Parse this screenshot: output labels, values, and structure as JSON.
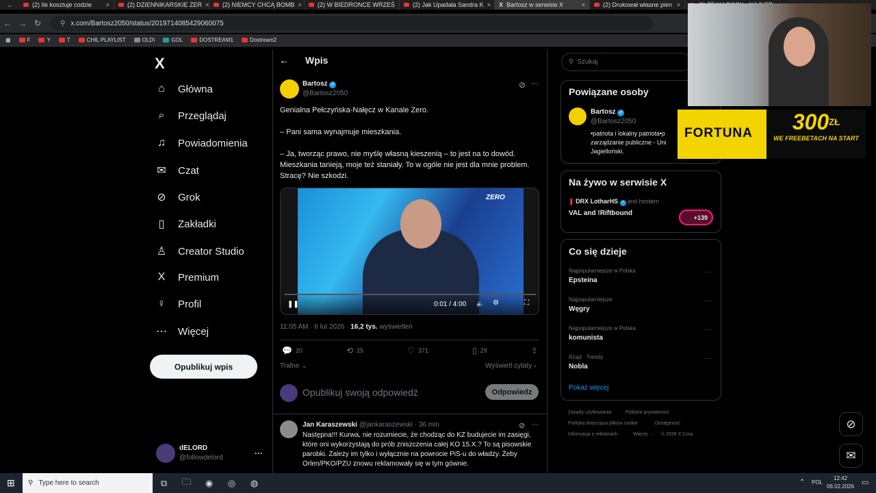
{
  "browser": {
    "tabs": [
      "(2) Ile kosztuje codzie",
      "(2) DZIENNIKARSKIE ZER",
      "(2) NIEMCY CHCĄ BOMB",
      "(2) W BIEDRONCE WRZEŚ",
      "(2) Jak Upadała Sandra K",
      "Bartosz w serwisie X",
      "(2) Drukował własne pien",
      "(2) TEAM ROCK - NAJLEP"
    ],
    "url": "x.com/Bartosz2050/status/2019714085429060075",
    "bookmarks": [
      "F",
      "Y",
      "T",
      "CHIL PLAYLIST",
      "OLD\\",
      "GOL",
      "DOSTREAM1",
      "Dostream2"
    ]
  },
  "nav": {
    "logo": "X",
    "items": [
      {
        "icon": "⌂",
        "label": "Główna"
      },
      {
        "icon": "⌕",
        "label": "Przeglądaj"
      },
      {
        "icon": "♫",
        "label": "Powiadomienia"
      },
      {
        "icon": "✉",
        "label": "Czat"
      },
      {
        "icon": "⊘",
        "label": "Grok"
      },
      {
        "icon": "▯",
        "label": "Zakładki"
      },
      {
        "icon": "♙",
        "label": "Creator Studio"
      },
      {
        "icon": "X",
        "label": "Premium"
      },
      {
        "icon": "♀",
        "label": "Profil"
      },
      {
        "icon": "⋯",
        "label": "Więcej"
      }
    ],
    "post_button": "Opublikuj wpis",
    "account": {
      "name": "dELORD",
      "handle": "@followdelord"
    }
  },
  "post": {
    "header": "Wpis",
    "author": "Bartosz",
    "handle": "@Bartosz2050",
    "lines": [
      "Genialna Pełczyńska-Nałęcz w Kanale Zero.",
      "– Pani sama wynajmuje mieszkania.",
      "– Ja, tworząc prawo, nie myślę własną kieszenią – to jest na to dowód. Mieszkania tanieją, moje też staniały. To w ogóle nie jest dla mnie problem. Stracę? Nie szkodzi."
    ],
    "video": {
      "watermark": "ZERO",
      "time": "0:01 / 4:00",
      "progress": 0.004
    },
    "time": "11:05 AM · 6 lut 2026 · ",
    "views": "16,2 tys.",
    "views_label": " wyświetleń",
    "stats": {
      "replies": "20",
      "reposts": "25",
      "likes": "371",
      "bookmarks": "29"
    },
    "sort": "Trafne",
    "quotes": "Wyświetl cytaty",
    "reply_placeholder": "Opublikuj swoją odpowiedź",
    "reply_button": "Odpowiedz"
  },
  "reply": {
    "author": "Jan Karaszewski",
    "meta": "@jankaraszewski · 36 min",
    "text": "Następna!!! Kurwa, nie rozumiecie, że chodząc do KZ budujecie im zasięgi, które oni wykorzystają do prób zniszczenia całej KO 15.X.? To są pisowskie parobki. Zależy im tylko i wyłącznie na powrocie PiS-u do władzy. Żeby Orlen/PKO/PZU znowu reklamowały się w tym gównie."
  },
  "right": {
    "search": "Szukaj",
    "related_title": "Powiązane osoby",
    "related": {
      "name": "Bartosz",
      "handle": "@Bartosz2050",
      "bio": "•patriota i lokalny patriota•p zarządzanie publiczne - Uni Jagielloński."
    },
    "live_title": "Na żywo w serwisie X",
    "live": {
      "host": "DRX LotharHS",
      "host_label": "jest hostem",
      "title": "VAL and !Riftbound",
      "count": "+139"
    },
    "trends_title": "Co się dzieje",
    "trends": [
      {
        "meta": "Najpopularniejsze w Polska",
        "name": "Epsteina"
      },
      {
        "meta": "Najpopularniejsze",
        "name": "Węgry"
      },
      {
        "meta": "Najpopularniejsze w Polska",
        "name": "komunista"
      },
      {
        "meta": "Rząd · Trendy",
        "name": "Nobla"
      }
    ],
    "more": "Pokaż więcej",
    "footer": [
      "Zasady użytkowania",
      "Polityka prywatności",
      "Polityka dotycząca plików cookie",
      "Dostępność",
      "Informacja o reklamach",
      "Więcej ···",
      "© 2026 X Corp."
    ]
  },
  "overlay": {
    "brand": "FORTUNA",
    "amount": "300",
    "currency": "ZŁ",
    "tagline": "WE FREEBETACH NA START"
  },
  "taskbar": {
    "search": "Type here to search",
    "lang": "POL",
    "time": "12:42",
    "date": "06.02.2026"
  }
}
